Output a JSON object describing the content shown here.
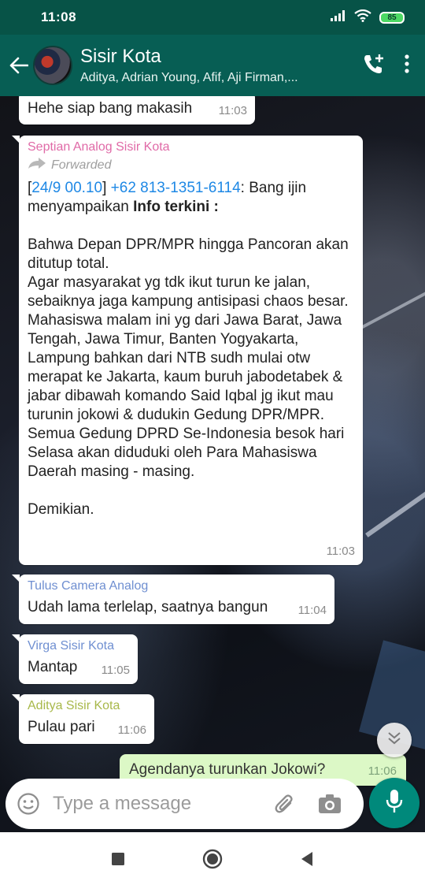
{
  "status_bar": {
    "time": "11:08",
    "battery": "85",
    "icons": [
      "signal-icon",
      "wifi-icon",
      "battery-icon"
    ]
  },
  "header": {
    "title": "Sisir Kota",
    "subtitle": "Aditya, Adrian Young, Afif, Aji Firman,...",
    "icons": [
      "back-arrow-icon",
      "add-call-icon",
      "more-vert-icon"
    ]
  },
  "messages": [
    {
      "text": "Hehe siap bang makasih",
      "time": "11:03"
    },
    {
      "sender": "Septian Analog Sisir Kota",
      "forwarded_label": "Forwarded",
      "quote_prefix": "[",
      "quote_link_date": "24/9 00.10",
      "quote_link_phone": "+62 813-1351-6114",
      "quote_after_link": ": Bang ijin",
      "line2_plain": "menyampaikan ",
      "line2_bold": "Info terkini :",
      "paragraphs": [
        "",
        "Bahwa Depan DPR/MPR hingga Pancoran akan ditutup total.",
        "Agar masyarakat yg tdk ikut turun ke jalan, sebaiknya jaga kampung antisipasi chaos besar.",
        "Mahasiswa malam ini yg dari Jawa Barat, Jawa Tengah, Jawa Timur, Banten Yogyakarta, Lampung bahkan dari NTB sudh mulai otw merapat ke Jakarta, kaum buruh jabodetabek & jabar dibawah komando Said Iqbal jg ikut mau turunin jokowi & dudukin Gedung DPR/MPR.",
        "Semua Gedung DPRD Se-Indonesia besok hari Selasa akan diduduki oleh Para Mahasiswa Daerah masing - masing.",
        "",
        "Demikian."
      ],
      "time": "11:03"
    },
    {
      "sender": "Tulus Camera Analog",
      "text": "Udah lama terlelap, saatnya bangun",
      "time": "11:04"
    },
    {
      "sender": "Virga Sisir Kota",
      "text": "Mantap",
      "time": "11:05"
    },
    {
      "sender": "Aditya Sisir Kota",
      "text": "Pulau pari",
      "time": "11:06"
    },
    {
      "text": "Agendanya turunkan Jokowi?",
      "time": "11:06",
      "outgoing": true
    }
  ],
  "input": {
    "placeholder": "Type a message",
    "icons": [
      "emoji-icon",
      "attach-icon",
      "camera-icon",
      "mic-icon"
    ]
  },
  "colors": {
    "header_bg": "#075e54",
    "status_bg": "#075347",
    "outgoing_bubble": "#dcf8c6",
    "mic_button": "#00897b",
    "link": "#1e88e5"
  }
}
